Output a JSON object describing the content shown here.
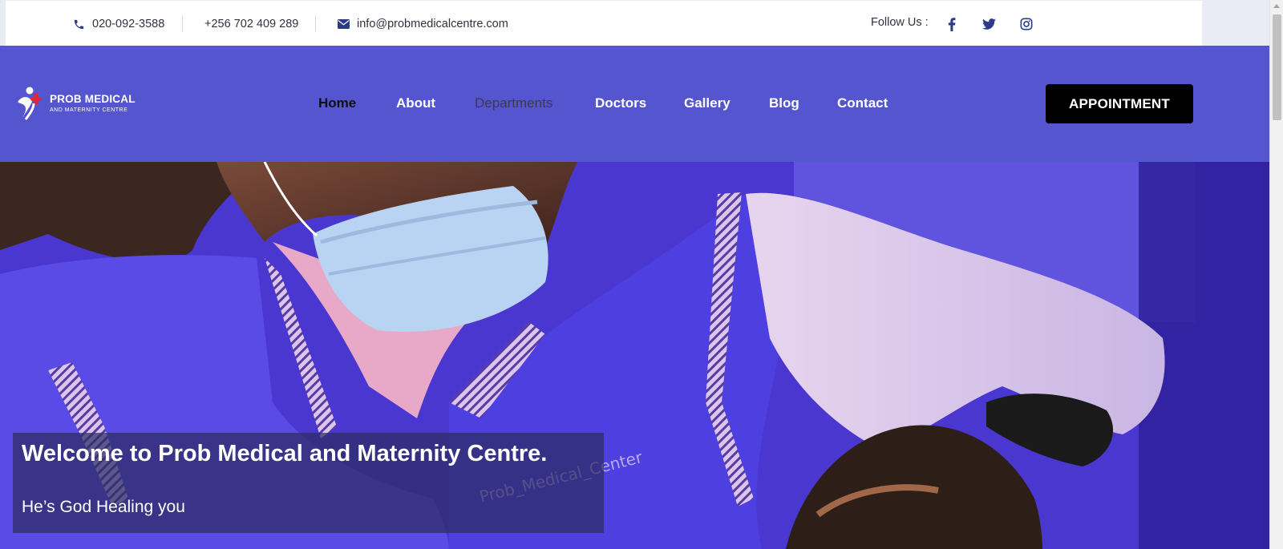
{
  "topbar": {
    "phone1": "020-092-3588",
    "phone2": "+256 702 409 289",
    "email": "info@probmedicalcentre.com",
    "follow_label": "Follow Us :",
    "social": [
      "facebook-icon",
      "twitter-icon",
      "instagram-icon"
    ]
  },
  "header": {
    "logo": {
      "line1": "PROB MEDICAL",
      "line2": "AND MATERNITY CENTRE"
    },
    "nav": [
      {
        "label": "Home",
        "state": "active"
      },
      {
        "label": "About",
        "state": "normal"
      },
      {
        "label": "Departments",
        "state": "hover"
      },
      {
        "label": "Doctors",
        "state": "normal"
      },
      {
        "label": "Gallery",
        "state": "normal"
      },
      {
        "label": "Blog",
        "state": "normal"
      },
      {
        "label": "Contact",
        "state": "normal"
      }
    ],
    "appointment_label": "APPOINTMENT"
  },
  "hero": {
    "title": "Welcome to Prob Medical and Maternity Centre.",
    "subtitle": "He’s God Healing you",
    "image_text": "Prob_Medical_Center"
  },
  "colors": {
    "header_bg": "#5555cf",
    "button_bg": "#000000",
    "topbar_icon": "#2d3a8c",
    "logo_red": "#e2272e"
  }
}
